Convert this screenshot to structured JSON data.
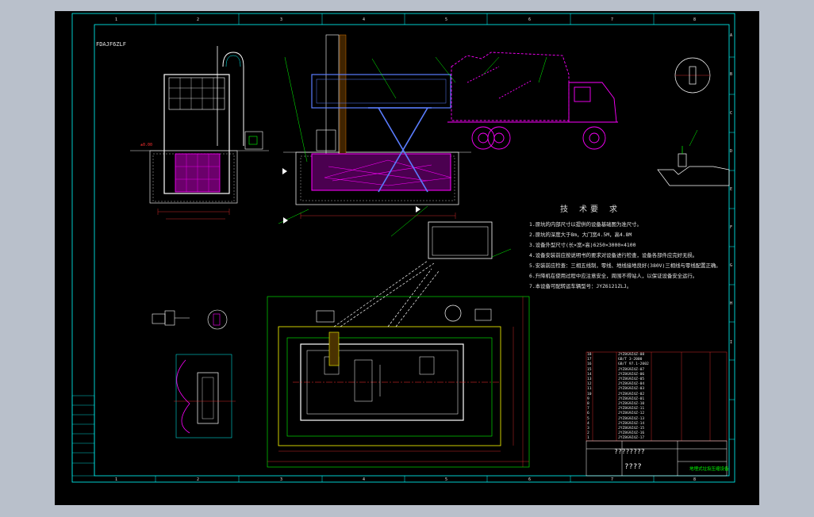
{
  "drawing_code": "FDAJF6ZLF",
  "technical_requirements": {
    "title": "技 术要 求",
    "items": [
      "1.原坑的内部尺寸以提供的设备基础图为准尺寸。",
      "2.原坑的深度大于8m，大门宽4.5M，高4.8M",
      "3.设备外型尺寸(长×宽×高)6250×3000×4100",
      "4.设备安装前应按说明书的要求对设备进行检查，设备各部件应完好无损。",
      "5.安装前应检查：三相五线制，零线、地线接地良好(380V)三相线与零线配置正确。",
      "6.升降机在使用过程中应注意安全，周围不得站人，以保证设备安全运行。",
      "7.本设备可配转运车辆型号：JYZ6121ZLJ。"
    ]
  },
  "title_block": {
    "drawing_title": "????????",
    "name": "????",
    "drawing_no": "地埋式垃圾压缩设备"
  },
  "frame": {
    "column_markers": [
      "1",
      "2",
      "3",
      "4",
      "5",
      "6",
      "7",
      "8"
    ],
    "row_markers": [
      "A",
      "B",
      "C",
      "D",
      "E",
      "F",
      "G",
      "H",
      "I"
    ]
  },
  "parts_list": [
    {
      "no": "18",
      "code": "JYZ8G9Z4Z-08"
    },
    {
      "no": "17",
      "code": "GB/T 3-2000"
    },
    {
      "no": "16",
      "code": "GB/T 97.1-2002"
    },
    {
      "no": "15",
      "code": "JYZ8G9Z4Z-07"
    },
    {
      "no": "14",
      "code": "JYZ8G9Z4Z-06"
    },
    {
      "no": "13",
      "code": "JYZ8G9Z4Z-05"
    },
    {
      "no": "12",
      "code": "JYZ8G9Z4Z-04"
    },
    {
      "no": "11",
      "code": "JYZ8G9Z4Z-03"
    },
    {
      "no": "10",
      "code": "JYZ8G9Z4Z-02"
    },
    {
      "no": "9",
      "code": "JYZ8G9Z4Z-01"
    },
    {
      "no": "8",
      "code": "JYZ8G9Z4Z-10"
    },
    {
      "no": "7",
      "code": "JYZ8G9Z4Z-11"
    },
    {
      "no": "6",
      "code": "JYZ8G9Z4Z-12"
    },
    {
      "no": "5",
      "code": "JYZ8G9Z4Z-13"
    },
    {
      "no": "4",
      "code": "JYZ8G9Z4Z-14"
    },
    {
      "no": "3",
      "code": "JYZ8G9Z4Z-15"
    },
    {
      "no": "2",
      "code": "JYZ8G9Z4Z-16"
    },
    {
      "no": "1",
      "code": "JYZ8G9Z4Z-17"
    }
  ],
  "colors": {
    "background": "#000000",
    "viewport": "#b9c0cb",
    "frame": "#00ffff",
    "machine": "#ff00ff",
    "scissor": "#5a7dff",
    "pit": "#e6e6e6",
    "callout": "#00ff00",
    "dimension": "#ff3030",
    "hatch": "#ffff00"
  }
}
